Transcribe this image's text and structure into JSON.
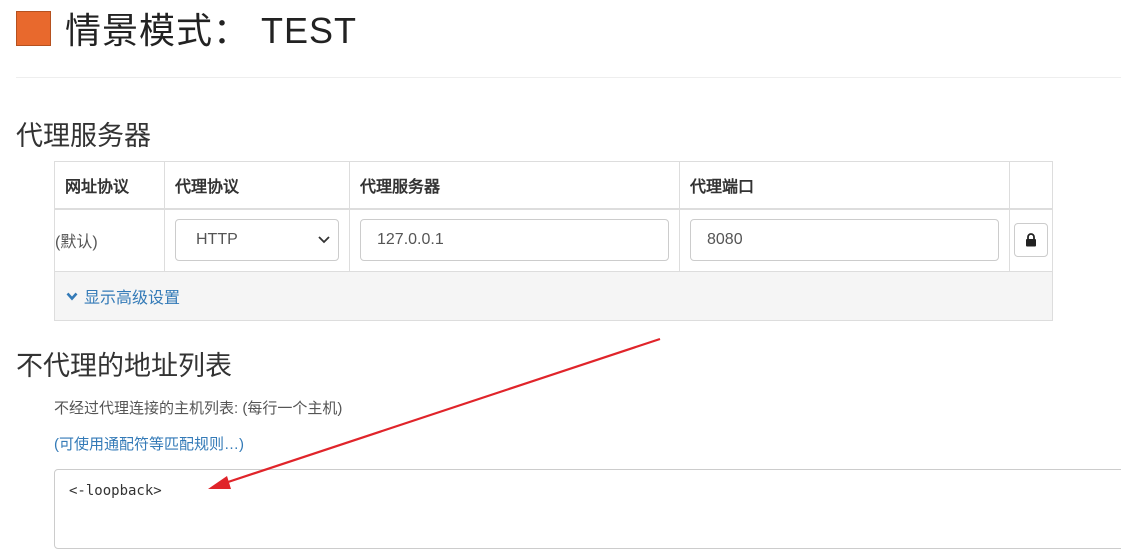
{
  "header": {
    "title": "情景模式： TEST",
    "swatch_color": "#e8692d"
  },
  "proxy_section": {
    "heading": "代理服务器",
    "columns": [
      "网址协议",
      "代理协议",
      "代理服务器",
      "代理端口"
    ],
    "row": {
      "url_scheme": "(默认)",
      "protocol": "HTTP",
      "server": "127.0.0.1",
      "port": "8080"
    },
    "lock_icon": "lock-icon",
    "advanced_label": "显示高级设置"
  },
  "bypass_section": {
    "heading": "不代理的地址列表",
    "description": "不经过代理连接的主机列表: (每行一个主机)",
    "wildcard_link": "(可使用通配符等匹配规则…)",
    "list_value": "<-loopback>"
  },
  "annotation": {
    "arrow_color": "#e0242a"
  }
}
